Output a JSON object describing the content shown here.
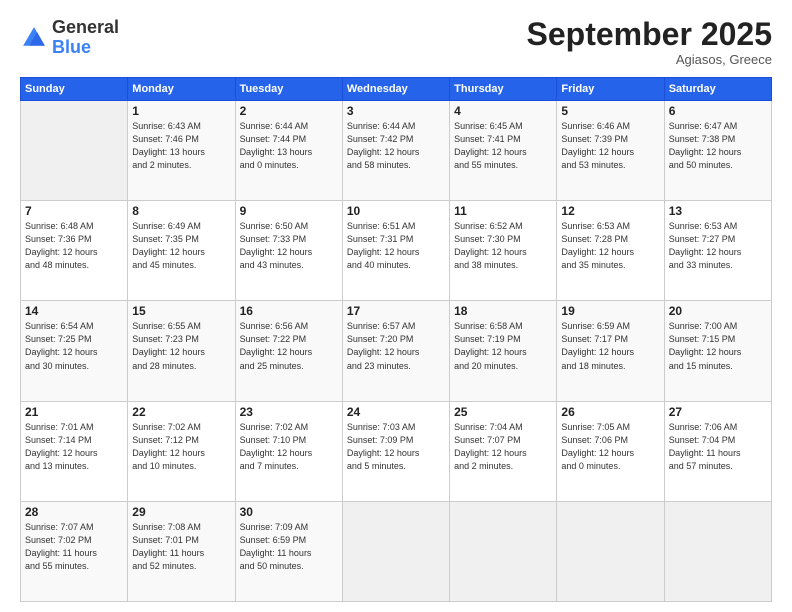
{
  "header": {
    "logo_general": "General",
    "logo_blue": "Blue",
    "month": "September 2025",
    "location": "Agiasos, Greece"
  },
  "weekdays": [
    "Sunday",
    "Monday",
    "Tuesday",
    "Wednesday",
    "Thursday",
    "Friday",
    "Saturday"
  ],
  "weeks": [
    [
      {
        "day": "",
        "detail": ""
      },
      {
        "day": "1",
        "detail": "Sunrise: 6:43 AM\nSunset: 7:46 PM\nDaylight: 13 hours\nand 2 minutes."
      },
      {
        "day": "2",
        "detail": "Sunrise: 6:44 AM\nSunset: 7:44 PM\nDaylight: 13 hours\nand 0 minutes."
      },
      {
        "day": "3",
        "detail": "Sunrise: 6:44 AM\nSunset: 7:42 PM\nDaylight: 12 hours\nand 58 minutes."
      },
      {
        "day": "4",
        "detail": "Sunrise: 6:45 AM\nSunset: 7:41 PM\nDaylight: 12 hours\nand 55 minutes."
      },
      {
        "day": "5",
        "detail": "Sunrise: 6:46 AM\nSunset: 7:39 PM\nDaylight: 12 hours\nand 53 minutes."
      },
      {
        "day": "6",
        "detail": "Sunrise: 6:47 AM\nSunset: 7:38 PM\nDaylight: 12 hours\nand 50 minutes."
      }
    ],
    [
      {
        "day": "7",
        "detail": "Sunrise: 6:48 AM\nSunset: 7:36 PM\nDaylight: 12 hours\nand 48 minutes."
      },
      {
        "day": "8",
        "detail": "Sunrise: 6:49 AM\nSunset: 7:35 PM\nDaylight: 12 hours\nand 45 minutes."
      },
      {
        "day": "9",
        "detail": "Sunrise: 6:50 AM\nSunset: 7:33 PM\nDaylight: 12 hours\nand 43 minutes."
      },
      {
        "day": "10",
        "detail": "Sunrise: 6:51 AM\nSunset: 7:31 PM\nDaylight: 12 hours\nand 40 minutes."
      },
      {
        "day": "11",
        "detail": "Sunrise: 6:52 AM\nSunset: 7:30 PM\nDaylight: 12 hours\nand 38 minutes."
      },
      {
        "day": "12",
        "detail": "Sunrise: 6:53 AM\nSunset: 7:28 PM\nDaylight: 12 hours\nand 35 minutes."
      },
      {
        "day": "13",
        "detail": "Sunrise: 6:53 AM\nSunset: 7:27 PM\nDaylight: 12 hours\nand 33 minutes."
      }
    ],
    [
      {
        "day": "14",
        "detail": "Sunrise: 6:54 AM\nSunset: 7:25 PM\nDaylight: 12 hours\nand 30 minutes."
      },
      {
        "day": "15",
        "detail": "Sunrise: 6:55 AM\nSunset: 7:23 PM\nDaylight: 12 hours\nand 28 minutes."
      },
      {
        "day": "16",
        "detail": "Sunrise: 6:56 AM\nSunset: 7:22 PM\nDaylight: 12 hours\nand 25 minutes."
      },
      {
        "day": "17",
        "detail": "Sunrise: 6:57 AM\nSunset: 7:20 PM\nDaylight: 12 hours\nand 23 minutes."
      },
      {
        "day": "18",
        "detail": "Sunrise: 6:58 AM\nSunset: 7:19 PM\nDaylight: 12 hours\nand 20 minutes."
      },
      {
        "day": "19",
        "detail": "Sunrise: 6:59 AM\nSunset: 7:17 PM\nDaylight: 12 hours\nand 18 minutes."
      },
      {
        "day": "20",
        "detail": "Sunrise: 7:00 AM\nSunset: 7:15 PM\nDaylight: 12 hours\nand 15 minutes."
      }
    ],
    [
      {
        "day": "21",
        "detail": "Sunrise: 7:01 AM\nSunset: 7:14 PM\nDaylight: 12 hours\nand 13 minutes."
      },
      {
        "day": "22",
        "detail": "Sunrise: 7:02 AM\nSunset: 7:12 PM\nDaylight: 12 hours\nand 10 minutes."
      },
      {
        "day": "23",
        "detail": "Sunrise: 7:02 AM\nSunset: 7:10 PM\nDaylight: 12 hours\nand 7 minutes."
      },
      {
        "day": "24",
        "detail": "Sunrise: 7:03 AM\nSunset: 7:09 PM\nDaylight: 12 hours\nand 5 minutes."
      },
      {
        "day": "25",
        "detail": "Sunrise: 7:04 AM\nSunset: 7:07 PM\nDaylight: 12 hours\nand 2 minutes."
      },
      {
        "day": "26",
        "detail": "Sunrise: 7:05 AM\nSunset: 7:06 PM\nDaylight: 12 hours\nand 0 minutes."
      },
      {
        "day": "27",
        "detail": "Sunrise: 7:06 AM\nSunset: 7:04 PM\nDaylight: 11 hours\nand 57 minutes."
      }
    ],
    [
      {
        "day": "28",
        "detail": "Sunrise: 7:07 AM\nSunset: 7:02 PM\nDaylight: 11 hours\nand 55 minutes."
      },
      {
        "day": "29",
        "detail": "Sunrise: 7:08 AM\nSunset: 7:01 PM\nDaylight: 11 hours\nand 52 minutes."
      },
      {
        "day": "30",
        "detail": "Sunrise: 7:09 AM\nSunset: 6:59 PM\nDaylight: 11 hours\nand 50 minutes."
      },
      {
        "day": "",
        "detail": ""
      },
      {
        "day": "",
        "detail": ""
      },
      {
        "day": "",
        "detail": ""
      },
      {
        "day": "",
        "detail": ""
      }
    ]
  ]
}
